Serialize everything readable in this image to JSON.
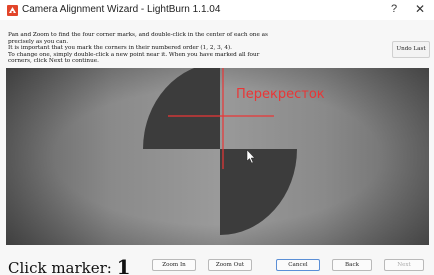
{
  "window": {
    "title": "Camera Alignment Wizard - LightBurn 1.1.04",
    "help_label": "?",
    "close_label": "✕",
    "icon": "lightburn-app-icon"
  },
  "instructions": {
    "lines": [
      "Pan and Zoom to find the four corner marks, and double-click in the center of each one as",
      "precisely as you can.",
      "It is important that you mark the corners in their numbered order (1, 2, 3, 4).",
      "To change one, simply double-click a new point near it.  When you have marked all four",
      "corners, click Next to continue."
    ]
  },
  "toolbar": {
    "undo_last_label": "Undo Last"
  },
  "overlay": {
    "label": "Перекресток",
    "color": "#ea3636"
  },
  "footer": {
    "click_marker_label": "Click marker:",
    "marker_number": "1",
    "zoom_in_label": "Zoom In",
    "zoom_out_label": "Zoom Out",
    "cancel_label": "Cancel",
    "back_label": "Back",
    "next_label": "Next"
  },
  "colors": {
    "accent_focus": "#5b8fd6",
    "crosshair": "#ea3636",
    "camera_background": "#7b7b7b",
    "marker_fill": "#3c3c3c"
  }
}
